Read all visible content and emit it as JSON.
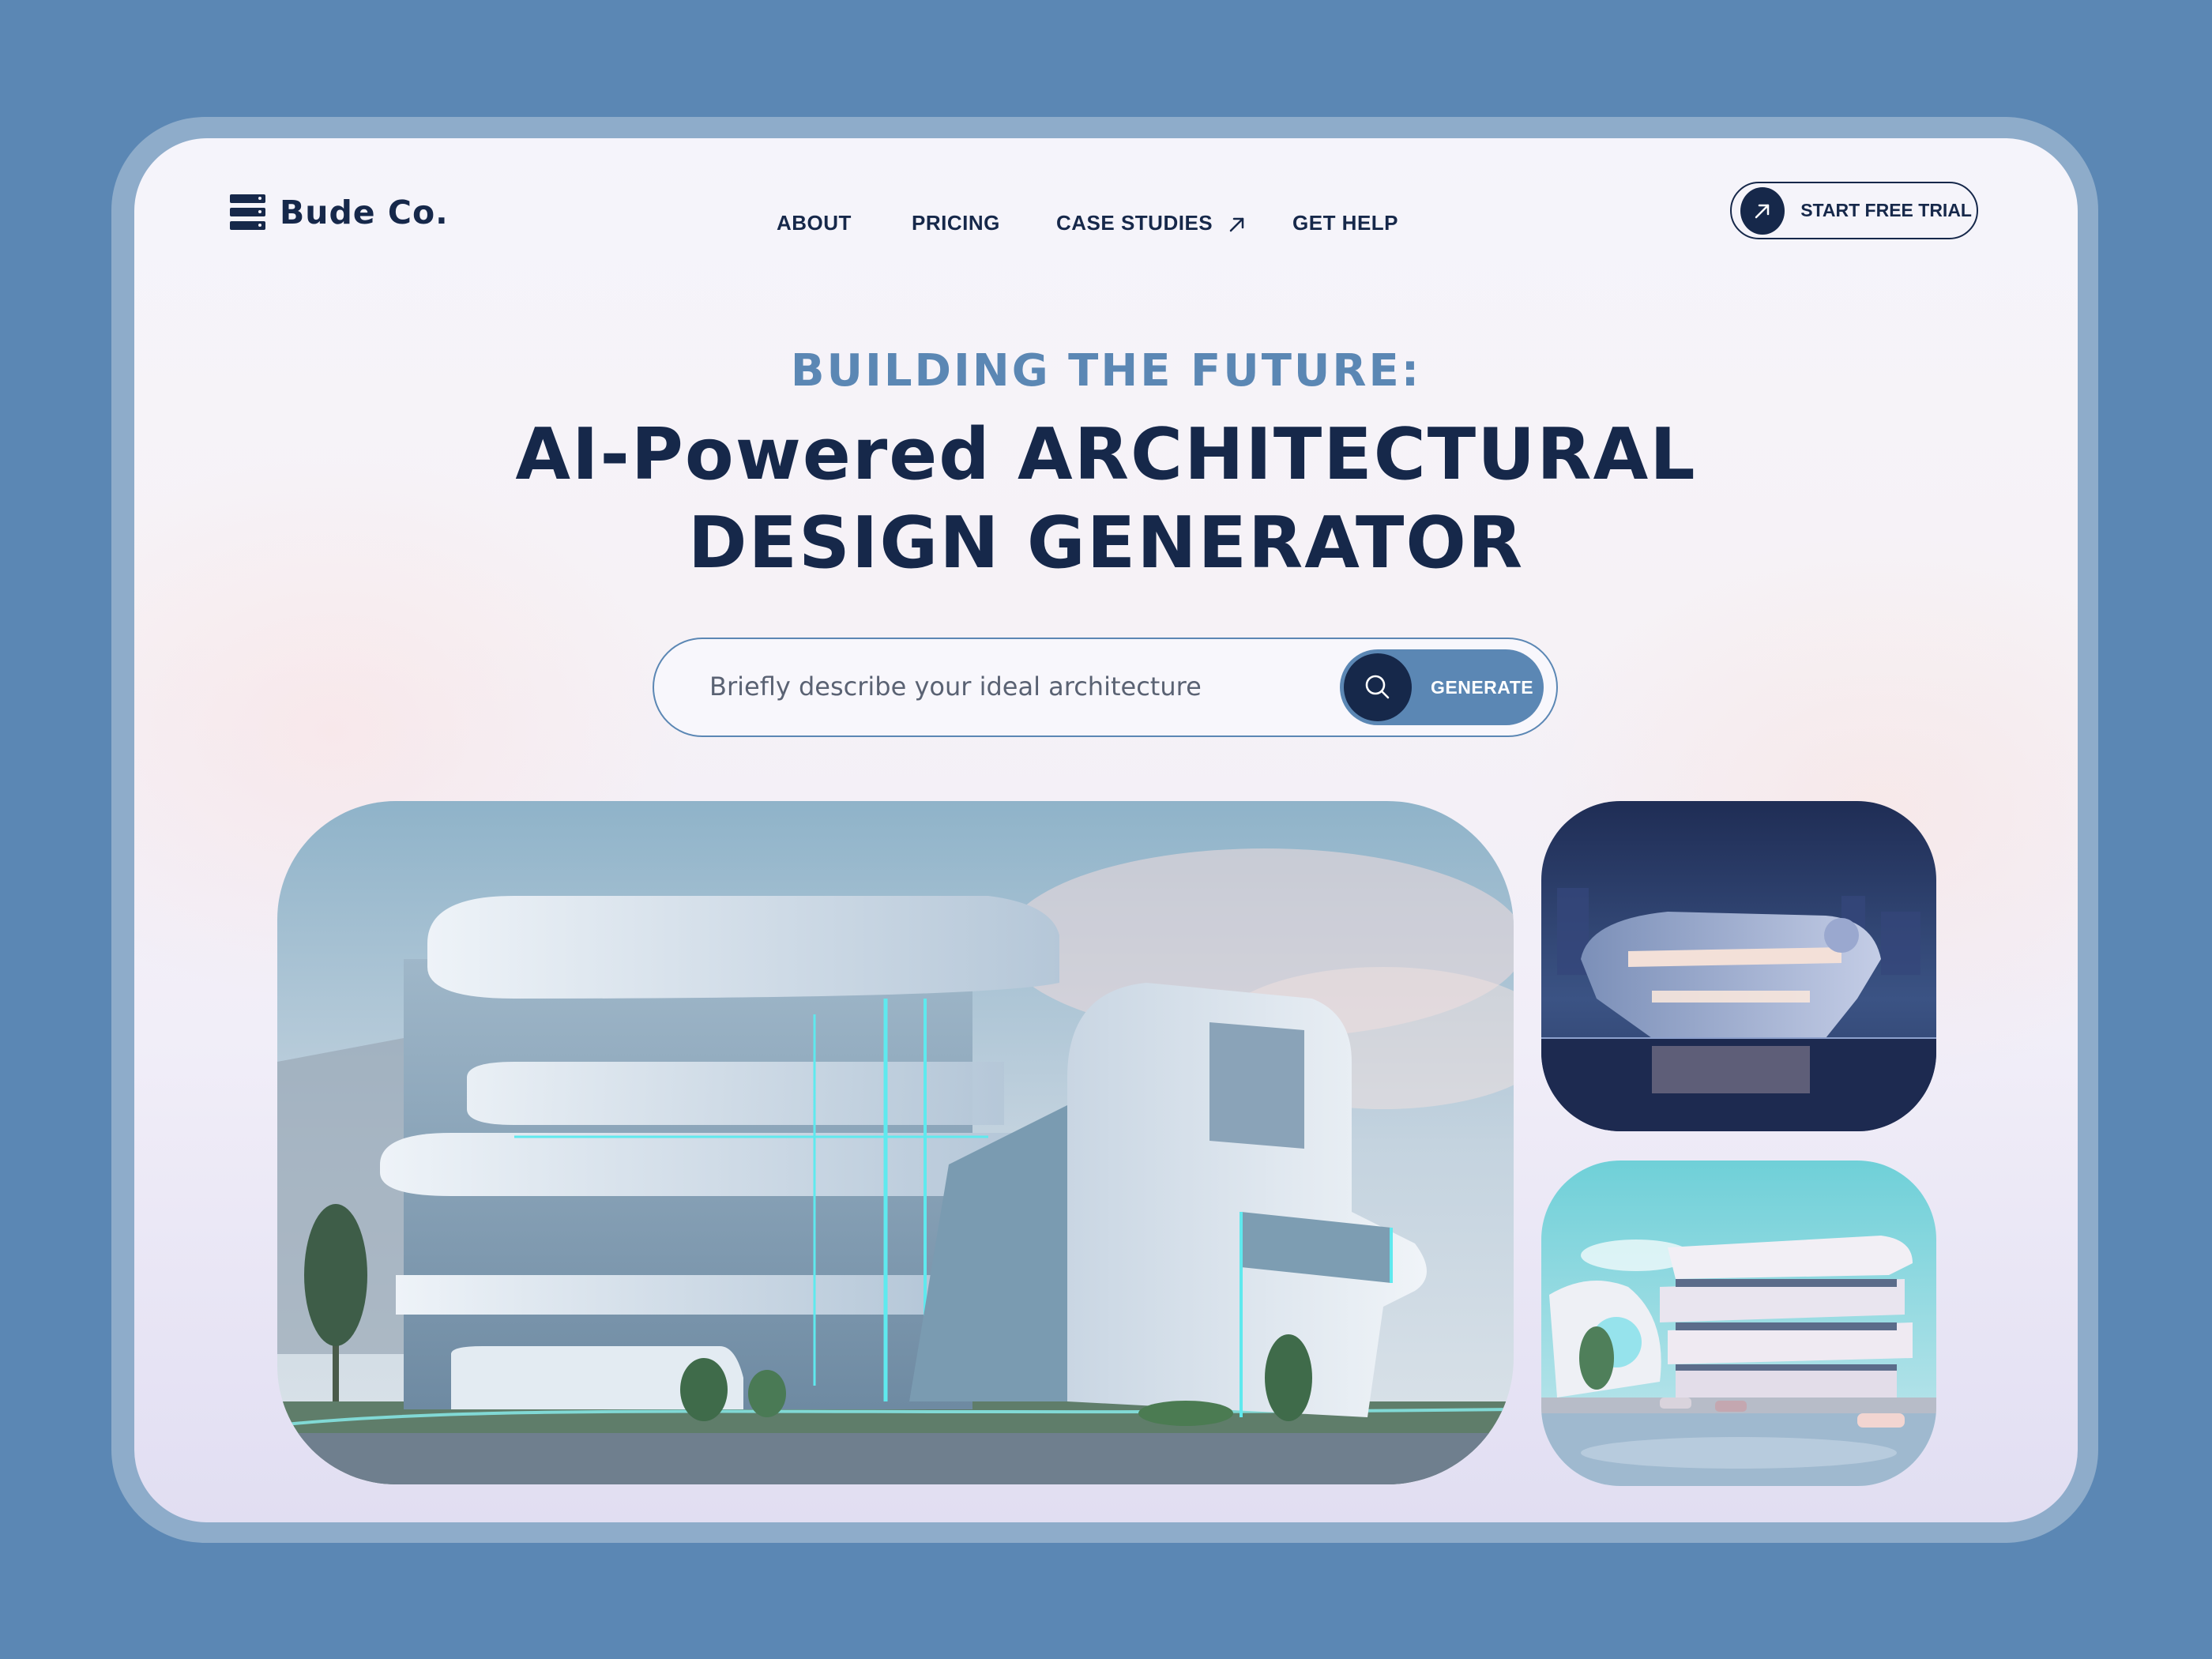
{
  "brand": {
    "name": "Bude Co.",
    "logo_icon": "server-stack-icon"
  },
  "nav": {
    "links": [
      {
        "label": "ABOUT"
      },
      {
        "label": "PRICING"
      },
      {
        "label": "CASE STUDIES",
        "icon": "arrow-up-right-icon"
      },
      {
        "label": "GET HELP"
      }
    ],
    "cta": {
      "label": "START FREE TRIAL",
      "icon": "arrow-up-right-icon"
    }
  },
  "hero": {
    "eyebrow": "BUILDING THE FUTURE:",
    "headline_line1": "AI-Powered ARCHITECTURAL",
    "headline_line2": "DESIGN GENERATOR"
  },
  "search": {
    "placeholder": "Briefly describe your ideal architecture",
    "value": "",
    "button_label": "GENERATE",
    "button_icon": "search-icon"
  },
  "gallery": [
    {
      "name": "futuristic-white-building-daytime"
    },
    {
      "name": "futuristic-building-night-waterfront"
    },
    {
      "name": "futuristic-building-street-waterfront"
    }
  ],
  "colors": {
    "background": "#5b87b4",
    "frame": "#8eacca",
    "navy": "#16284a",
    "accent": "#5b87b4",
    "card": "#f5f4fb"
  }
}
